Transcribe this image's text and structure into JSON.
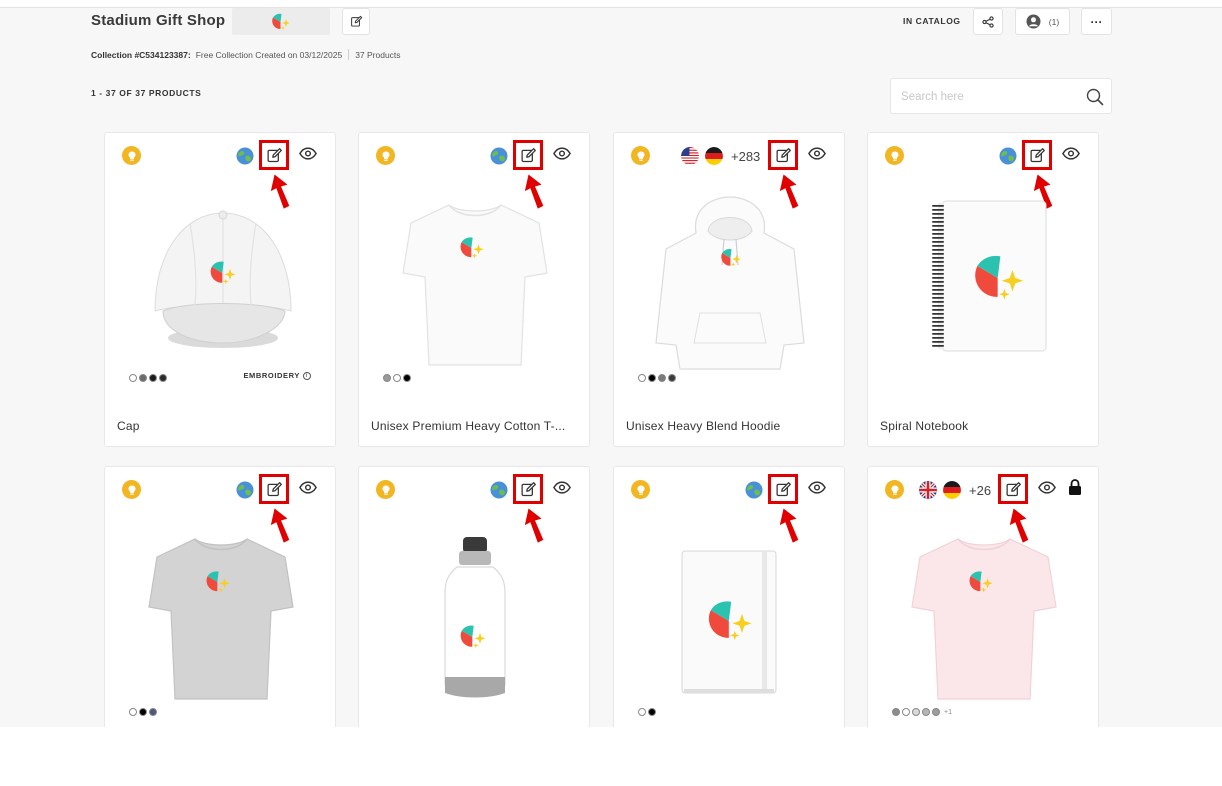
{
  "header": {
    "shop_title": "Stadium Gift Shop",
    "catalog_status": "IN CATALOG",
    "users_count": "(1)"
  },
  "collection": {
    "id_label": "Collection #C534123387:",
    "description": "Free Collection Created on 03/12/2025",
    "product_count": "37 Products"
  },
  "listing": {
    "count_label": "1 - 37 OF 37 PRODUCTS"
  },
  "search": {
    "placeholder": "Search here",
    "value": ""
  },
  "colors": {
    "accent_highlight": "#e00000",
    "bulb": "#f3b623"
  },
  "products": [
    {
      "name": "Cap",
      "image": "cap",
      "markets": [
        "globe-icon"
      ],
      "extra_markets": "",
      "swatches": [
        "#ffffff",
        "#6b6b6b",
        "#1a1a1a",
        "#2b2b2b"
      ],
      "more_swatches": "",
      "decoration": "EMBROIDERY",
      "locked": false
    },
    {
      "name": "Unisex Premium Heavy Cotton T-...",
      "image": "tshirt-white",
      "markets": [
        "globe-icon"
      ],
      "extra_markets": "",
      "swatches": [
        "#9a9a9a",
        "#ffffff",
        "#000000"
      ],
      "more_swatches": "",
      "decoration": "",
      "locked": false
    },
    {
      "name": "Unisex Heavy Blend Hoodie",
      "image": "hoodie",
      "markets": [
        "us-flag-icon",
        "de-flag-icon"
      ],
      "extra_markets": "+283",
      "swatches": [
        "#ffffff",
        "#000000",
        "#7a7a7a",
        "#3a3a3a"
      ],
      "more_swatches": "",
      "decoration": "",
      "locked": false
    },
    {
      "name": "Spiral Notebook",
      "image": "spiral-notebook",
      "markets": [
        "globe-icon"
      ],
      "extra_markets": "",
      "swatches": [],
      "more_swatches": "",
      "decoration": "",
      "locked": false
    },
    {
      "name": "",
      "image": "tshirt-gray",
      "markets": [
        "globe-icon"
      ],
      "extra_markets": "",
      "swatches": [
        "#ffffff",
        "#000000",
        "#4a5a7a"
      ],
      "more_swatches": "",
      "decoration": "",
      "locked": false
    },
    {
      "name": "",
      "image": "water-bottle",
      "markets": [
        "globe-icon"
      ],
      "extra_markets": "",
      "swatches": [],
      "more_swatches": "",
      "decoration": "",
      "locked": false
    },
    {
      "name": "",
      "image": "hardcover-journal",
      "markets": [
        "globe-icon"
      ],
      "extra_markets": "",
      "swatches": [
        "#ffffff",
        "#000000"
      ],
      "more_swatches": "",
      "decoration": "",
      "locked": false
    },
    {
      "name": "",
      "image": "tshirt-pink",
      "markets": [
        "uk-flag-icon",
        "de-flag-icon"
      ],
      "extra_markets": "+26",
      "swatches": [
        "#8c8c8c",
        "#ffffff",
        "#d9d9d9",
        "#b5b5b5",
        "#9c9c9c"
      ],
      "more_swatches": "+1",
      "decoration": "",
      "locked": true
    }
  ]
}
